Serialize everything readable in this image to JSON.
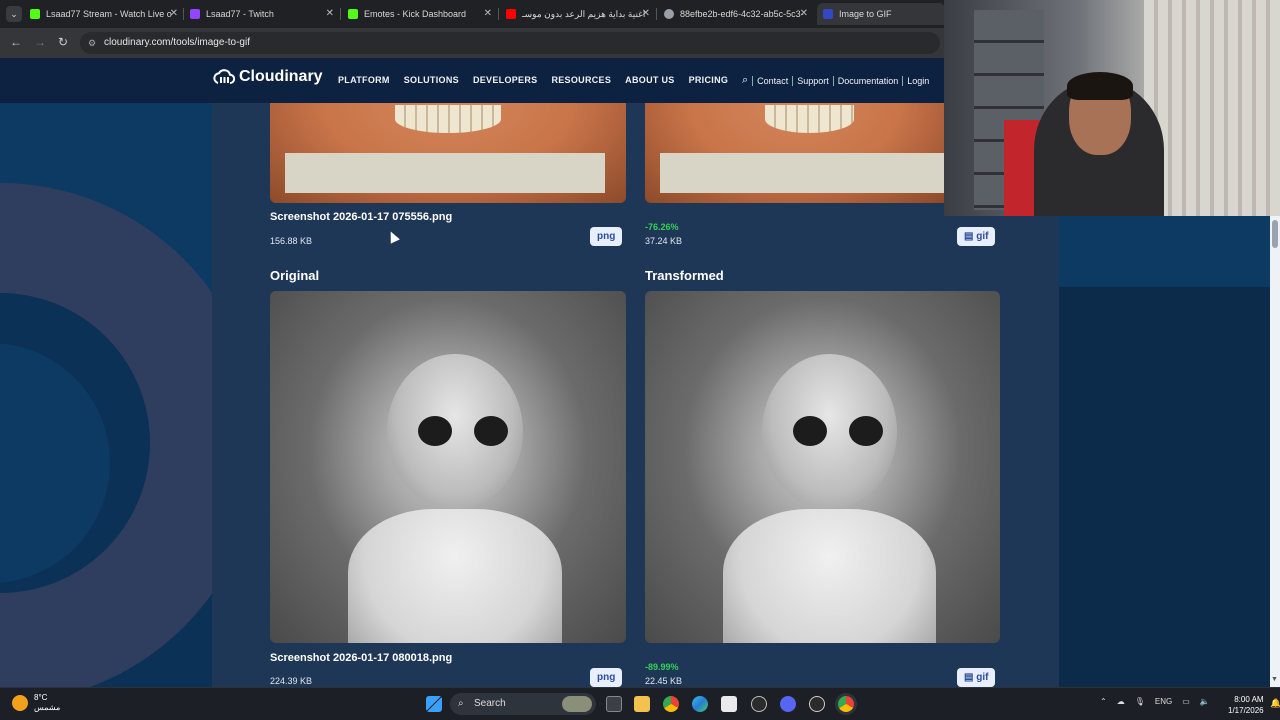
{
  "browser": {
    "tabs": [
      {
        "title": "Lsaad77 Stream - Watch Live o",
        "favicon": "kick-icon",
        "color": "#53fc18",
        "active": false
      },
      {
        "title": "Lsaad77 - Twitch",
        "favicon": "twitch-icon",
        "color": "#9146ff",
        "active": false
      },
      {
        "title": "Emotes - Kick Dashboard",
        "favicon": "kick-icon",
        "color": "#53fc18",
        "active": false
      },
      {
        "title": "اغنية بداية هزيم الرعد بدون موسـ",
        "favicon": "youtube-icon",
        "color": "#ff0000",
        "active": false
      },
      {
        "title": "88efbe2b-edf6-4c32-ab5c-5c3-",
        "favicon": "globe-icon",
        "color": "#9aa0a6",
        "active": false
      },
      {
        "title": "Image to GIF",
        "favicon": "cloudinary-icon",
        "color": "#3448c5",
        "active": true
      }
    ],
    "url": "cloudinary.com/tools/image-to-gif"
  },
  "site": {
    "logo": "Cloudinary",
    "nav": [
      "PLATFORM",
      "SOLUTIONS",
      "DEVELOPERS",
      "RESOURCES",
      "ABOUT US",
      "PRICING"
    ],
    "right_links": [
      "Contact",
      "Support",
      "Documentation",
      "Login"
    ]
  },
  "results": {
    "first": {
      "filename": "Screenshot 2026-01-17 075556.png",
      "size": "156.88 KB",
      "orig_badge": "png",
      "reduction": "-76.26%",
      "transformed_size": "37.24 KB",
      "trans_badge": "gif"
    },
    "second": {
      "original_title": "Original",
      "transformed_title": "Transformed",
      "filename": "Screenshot 2026-01-17 080018.png",
      "size": "224.39 KB",
      "orig_badge": "png",
      "reduction": "-89.99%",
      "transformed_size": "22.45 KB",
      "trans_badge": "gif"
    }
  },
  "taskbar": {
    "weather_temp": "8°C",
    "weather_text": "مشمس",
    "search_placeholder": "Search",
    "lang": "ENG",
    "time": "8:00 AM",
    "date": "1/17/2026"
  }
}
